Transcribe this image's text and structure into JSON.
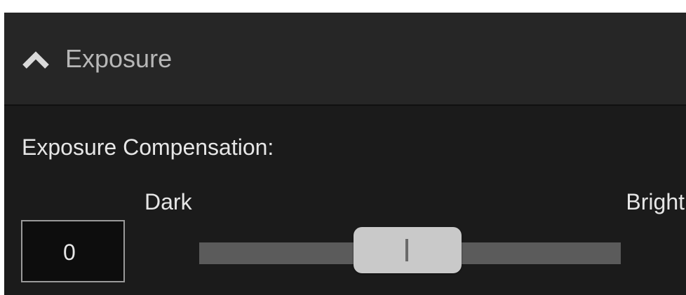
{
  "section": {
    "title": "Exposure",
    "icon": "chevron-up-icon",
    "expanded": true
  },
  "exposure_compensation": {
    "label": "Exposure Compensation:",
    "value": "0",
    "min_label": "Dark",
    "max_label": "Bright",
    "slider_position_fraction": 0.49
  },
  "colors": {
    "panel_background": "#1b1b1b",
    "header_background": "#262626",
    "track": "#5b5b5b",
    "thumb": "#c9c9c9",
    "text": "#e6e6e6"
  }
}
